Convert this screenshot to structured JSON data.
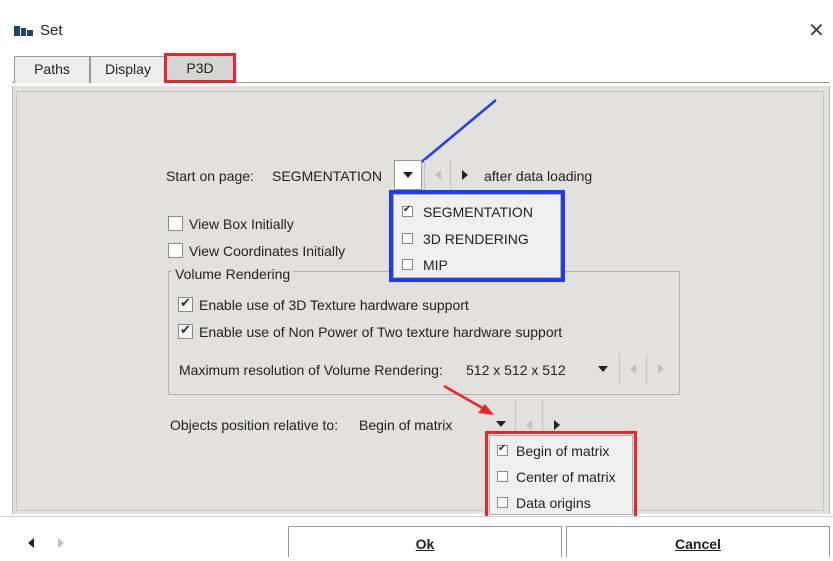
{
  "window": {
    "title": "Set",
    "icon": "app-icon"
  },
  "tabs": [
    {
      "label": "Paths"
    },
    {
      "label": "Display"
    },
    {
      "label": "P3D",
      "active": true
    }
  ],
  "start_page": {
    "label": "Start on page:",
    "value": "SEGMENTATION",
    "suffix": "after data loading",
    "options": [
      {
        "label": "SEGMENTATION",
        "checked": true
      },
      {
        "label": "3D RENDERING",
        "checked": false
      },
      {
        "label": "MIP",
        "checked": false
      }
    ]
  },
  "checkboxes": {
    "view_box": {
      "label": "View Box Initially",
      "checked": false
    },
    "view_coords": {
      "label": "View Coordinates Initially",
      "checked": false
    }
  },
  "volume_rendering": {
    "title": "Volume Rendering",
    "texture_3d": {
      "label": "Enable use of 3D Texture hardware support",
      "checked": true
    },
    "npot": {
      "label": "Enable use of Non Power of Two texture hardware support",
      "checked": true
    },
    "max_res": {
      "label": "Maximum resolution of Volume Rendering:",
      "value": "512 x 512 x 512"
    }
  },
  "objects_position": {
    "label": "Objects position relative to:",
    "value": "Begin of matrix",
    "options": [
      {
        "label": "Begin of matrix",
        "checked": true
      },
      {
        "label": "Center of matrix",
        "checked": false
      },
      {
        "label": "Data origins",
        "checked": false
      }
    ]
  },
  "footer": {
    "ok_label": "Ok",
    "cancel_label": "Cancel"
  },
  "colors": {
    "highlight_red": "#e8262b",
    "highlight_blue": "#1f3cf0",
    "panel_bg": "#e3e1de"
  }
}
